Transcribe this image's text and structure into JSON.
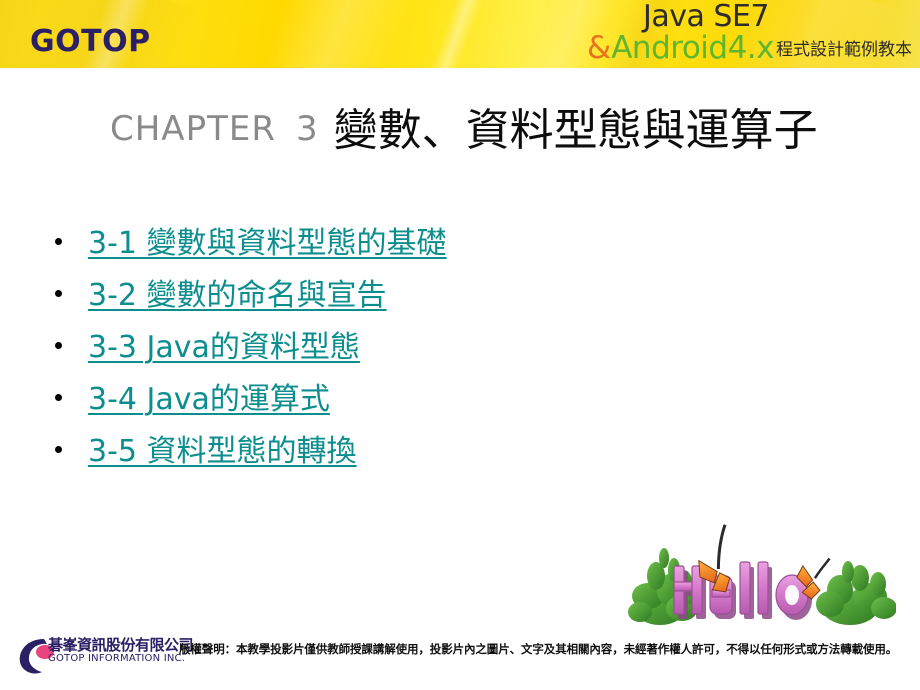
{
  "header": {
    "brand_logo": "GOTOP",
    "book": {
      "line1": "Java SE7",
      "amp": "&",
      "line2": "Android4.x",
      "subtitle_cn": "程式設計範例教本"
    },
    "colors": {
      "banner_yellow": "#ffd900",
      "brand_navy": "#2b2065",
      "amp_orange": "#e8731d",
      "android_green": "#5fb62e"
    }
  },
  "slide": {
    "chapter_word": "CHAPTER",
    "chapter_number": "3",
    "chapter_title_cn": "變數、資料型態與運算子",
    "title_color": "#8a8a8a",
    "link_color": "#0c8e8e"
  },
  "toc": {
    "items": [
      {
        "num": "3-1",
        "cn": "變數與資料型態的基礎"
      },
      {
        "num": "3-2",
        "cn": "變數的命名與宣告"
      },
      {
        "num": "3-3 Java",
        "cn": "的資料型態"
      },
      {
        "num": "3-4 Java",
        "cn": "的運算式"
      },
      {
        "num": "3-5",
        "cn": "資料型態的轉換"
      }
    ]
  },
  "decoration": {
    "hello_image_alt": "Hello",
    "hello_word": "Hello"
  },
  "footer": {
    "logo_cn": "碁峯資訊股份有限公司",
    "logo_en": "GOTOP INFORMATION INC.",
    "copyright": "版權聲明：本教學投影片僅供教師授課講解使用，投影片內之圖片、文字及其相關內容，未經著作權人許可，不得以任何形式或方法轉載使用。"
  }
}
